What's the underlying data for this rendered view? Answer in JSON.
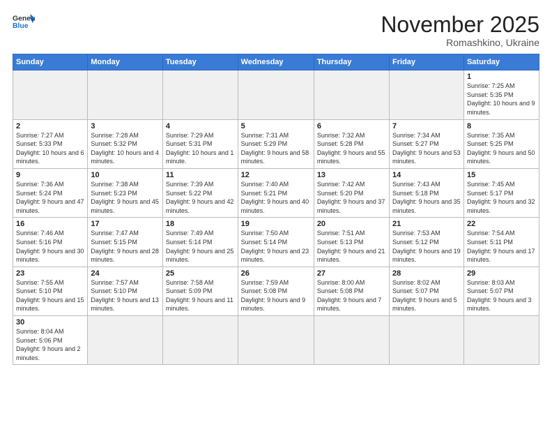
{
  "header": {
    "logo_general": "General",
    "logo_blue": "Blue",
    "month": "November 2025",
    "location": "Romashkino, Ukraine"
  },
  "days_of_week": [
    "Sunday",
    "Monday",
    "Tuesday",
    "Wednesday",
    "Thursday",
    "Friday",
    "Saturday"
  ],
  "weeks": [
    [
      {
        "day": "",
        "info": ""
      },
      {
        "day": "",
        "info": ""
      },
      {
        "day": "",
        "info": ""
      },
      {
        "day": "",
        "info": ""
      },
      {
        "day": "",
        "info": ""
      },
      {
        "day": "",
        "info": ""
      },
      {
        "day": "1",
        "info": "Sunrise: 7:25 AM\nSunset: 5:35 PM\nDaylight: 10 hours and 9 minutes."
      }
    ],
    [
      {
        "day": "2",
        "info": "Sunrise: 7:27 AM\nSunset: 5:33 PM\nDaylight: 10 hours and 6 minutes."
      },
      {
        "day": "3",
        "info": "Sunrise: 7:28 AM\nSunset: 5:32 PM\nDaylight: 10 hours and 4 minutes."
      },
      {
        "day": "4",
        "info": "Sunrise: 7:29 AM\nSunset: 5:31 PM\nDaylight: 10 hours and 1 minute."
      },
      {
        "day": "5",
        "info": "Sunrise: 7:31 AM\nSunset: 5:29 PM\nDaylight: 9 hours and 58 minutes."
      },
      {
        "day": "6",
        "info": "Sunrise: 7:32 AM\nSunset: 5:28 PM\nDaylight: 9 hours and 55 minutes."
      },
      {
        "day": "7",
        "info": "Sunrise: 7:34 AM\nSunset: 5:27 PM\nDaylight: 9 hours and 53 minutes."
      },
      {
        "day": "8",
        "info": "Sunrise: 7:35 AM\nSunset: 5:25 PM\nDaylight: 9 hours and 50 minutes."
      }
    ],
    [
      {
        "day": "9",
        "info": "Sunrise: 7:36 AM\nSunset: 5:24 PM\nDaylight: 9 hours and 47 minutes."
      },
      {
        "day": "10",
        "info": "Sunrise: 7:38 AM\nSunset: 5:23 PM\nDaylight: 9 hours and 45 minutes."
      },
      {
        "day": "11",
        "info": "Sunrise: 7:39 AM\nSunset: 5:22 PM\nDaylight: 9 hours and 42 minutes."
      },
      {
        "day": "12",
        "info": "Sunrise: 7:40 AM\nSunset: 5:21 PM\nDaylight: 9 hours and 40 minutes."
      },
      {
        "day": "13",
        "info": "Sunrise: 7:42 AM\nSunset: 5:20 PM\nDaylight: 9 hours and 37 minutes."
      },
      {
        "day": "14",
        "info": "Sunrise: 7:43 AM\nSunset: 5:18 PM\nDaylight: 9 hours and 35 minutes."
      },
      {
        "day": "15",
        "info": "Sunrise: 7:45 AM\nSunset: 5:17 PM\nDaylight: 9 hours and 32 minutes."
      }
    ],
    [
      {
        "day": "16",
        "info": "Sunrise: 7:46 AM\nSunset: 5:16 PM\nDaylight: 9 hours and 30 minutes."
      },
      {
        "day": "17",
        "info": "Sunrise: 7:47 AM\nSunset: 5:15 PM\nDaylight: 9 hours and 28 minutes."
      },
      {
        "day": "18",
        "info": "Sunrise: 7:49 AM\nSunset: 5:14 PM\nDaylight: 9 hours and 25 minutes."
      },
      {
        "day": "19",
        "info": "Sunrise: 7:50 AM\nSunset: 5:14 PM\nDaylight: 9 hours and 23 minutes."
      },
      {
        "day": "20",
        "info": "Sunrise: 7:51 AM\nSunset: 5:13 PM\nDaylight: 9 hours and 21 minutes."
      },
      {
        "day": "21",
        "info": "Sunrise: 7:53 AM\nSunset: 5:12 PM\nDaylight: 9 hours and 19 minutes."
      },
      {
        "day": "22",
        "info": "Sunrise: 7:54 AM\nSunset: 5:11 PM\nDaylight: 9 hours and 17 minutes."
      }
    ],
    [
      {
        "day": "23",
        "info": "Sunrise: 7:55 AM\nSunset: 5:10 PM\nDaylight: 9 hours and 15 minutes."
      },
      {
        "day": "24",
        "info": "Sunrise: 7:57 AM\nSunset: 5:10 PM\nDaylight: 9 hours and 13 minutes."
      },
      {
        "day": "25",
        "info": "Sunrise: 7:58 AM\nSunset: 5:09 PM\nDaylight: 9 hours and 11 minutes."
      },
      {
        "day": "26",
        "info": "Sunrise: 7:59 AM\nSunset: 5:08 PM\nDaylight: 9 hours and 9 minutes."
      },
      {
        "day": "27",
        "info": "Sunrise: 8:00 AM\nSunset: 5:08 PM\nDaylight: 9 hours and 7 minutes."
      },
      {
        "day": "28",
        "info": "Sunrise: 8:02 AM\nSunset: 5:07 PM\nDaylight: 9 hours and 5 minutes."
      },
      {
        "day": "29",
        "info": "Sunrise: 8:03 AM\nSunset: 5:07 PM\nDaylight: 9 hours and 3 minutes."
      }
    ],
    [
      {
        "day": "30",
        "info": "Sunrise: 8:04 AM\nSunset: 5:06 PM\nDaylight: 9 hours and 2 minutes."
      },
      {
        "day": "",
        "info": ""
      },
      {
        "day": "",
        "info": ""
      },
      {
        "day": "",
        "info": ""
      },
      {
        "day": "",
        "info": ""
      },
      {
        "day": "",
        "info": ""
      },
      {
        "day": "",
        "info": ""
      }
    ]
  ]
}
